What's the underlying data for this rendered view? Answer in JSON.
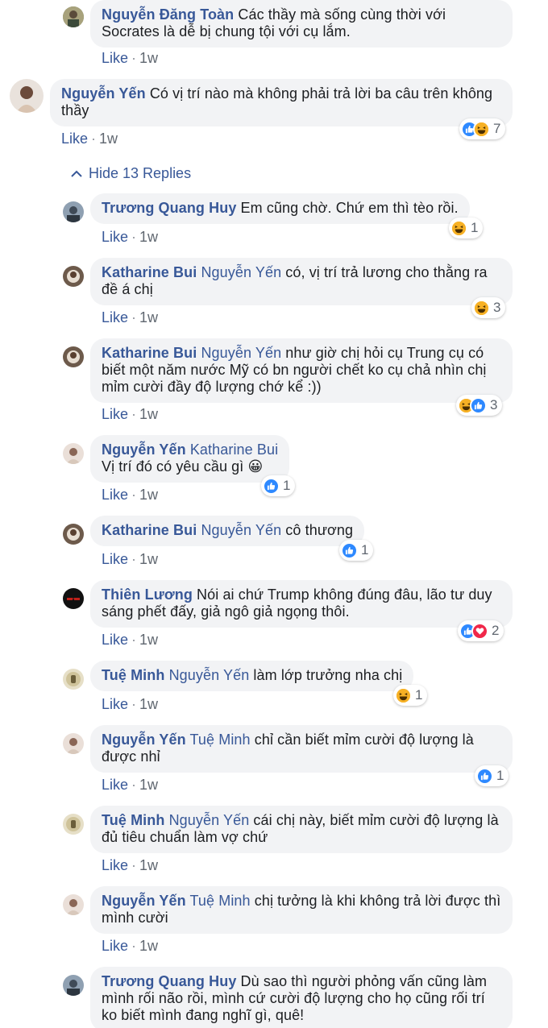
{
  "comments": [
    {
      "author": "Nguyễn Đăng Toàn",
      "tag": "",
      "text": "Các thầy mà sống cùng thời với Socrates là dễ bị chung tội với cụ lắm.",
      "like": "Like",
      "time": "1w",
      "reactions": "",
      "icons": []
    },
    {
      "author": "Nguyễn Yến",
      "tag": "",
      "text": "Có vị trí nào mà không phải trả lời ba câu trên không thầy",
      "like": "Like",
      "time": "1w",
      "reactions": "7",
      "icons": [
        "like-icon",
        "haha-icon"
      ]
    },
    {
      "author": "Trương Quang Huy",
      "tag": "",
      "text": "Em cũng chờ. Chứ em thì tèo rồi.",
      "like": "Like",
      "time": "1w",
      "reactions": "1",
      "icons": [
        "haha-icon"
      ]
    },
    {
      "author": "Katharine Bui",
      "tag": "Nguyễn Yến",
      "text": "có, vị trí trả lương cho thằng ra đề á chị",
      "like": "Like",
      "time": "1w",
      "reactions": "3",
      "icons": [
        "haha-icon"
      ]
    },
    {
      "author": "Katharine Bui",
      "tag": "Nguyễn Yến",
      "text": "như giờ chị hỏi cụ Trung cụ có biết một năm nước Mỹ có bn người chết ko cụ chả nhìn chị mỉm cười đầy độ lượng chớ kể :))",
      "like": "Like",
      "time": "1w",
      "reactions": "3",
      "icons": [
        "haha-icon",
        "like-icon"
      ]
    },
    {
      "author": "Nguyễn Yến",
      "tag": "Katharine Bui",
      "text": "Vị trí đó có yêu cầu gì 😀",
      "like": "Like",
      "time": "1w",
      "reactions": "1",
      "icons": [
        "like-icon"
      ]
    },
    {
      "author": "Katharine Bui",
      "tag": "Nguyễn Yến",
      "text": "cô thương",
      "like": "Like",
      "time": "1w",
      "reactions": "1",
      "icons": [
        "like-icon"
      ]
    },
    {
      "author": "Thiên Lương",
      "tag": "",
      "text": "Nói ai chứ Trump không đúng đâu, lão tư duy sáng phết đấy, giả ngô giả ngọng thôi.",
      "like": "Like",
      "time": "1w",
      "reactions": "2",
      "icons": [
        "like-icon",
        "love-icon"
      ]
    },
    {
      "author": "Tuệ Minh",
      "tag": "Nguyễn Yến",
      "text": "làm lớp trưởng nha chị",
      "like": "Like",
      "time": "1w",
      "reactions": "1",
      "icons": [
        "haha-icon"
      ]
    },
    {
      "author": "Nguyễn Yến",
      "tag": "Tuệ Minh",
      "text": "chỉ cần biết mỉm cười độ lượng là được nhỉ",
      "like": "Like",
      "time": "1w",
      "reactions": "1",
      "icons": [
        "like-icon"
      ]
    },
    {
      "author": "Tuệ Minh",
      "tag": "Nguyễn Yến",
      "text": "cái chị này, biết mỉm cười độ lượng là đủ tiêu chuẩn làm vợ chứ",
      "like": "Like",
      "time": "1w",
      "reactions": "",
      "icons": []
    },
    {
      "author": "Nguyễn Yến",
      "tag": "Tuệ Minh",
      "text": "chị tưởng là khi không trả lời được thì mình cười",
      "like": "Like",
      "time": "1w",
      "reactions": "",
      "icons": []
    },
    {
      "author": "Trương Quang Huy",
      "tag": "",
      "text": "Dù sao thì người phỏng vấn cũng làm mình rối não rồi, mình cứ cười độ lượng cho họ cũng rối trí ko biết mình đang nghĩ gì, quê!",
      "like": "Like",
      "time": "",
      "reactions": "",
      "icons": []
    }
  ],
  "hide_replies": "Hide 13 Replies",
  "colors": {
    "link": "#385898",
    "bubble": "#f2f3f5",
    "like": "#2e89ff",
    "haha": "#f7b125",
    "love": "#f0284a"
  }
}
